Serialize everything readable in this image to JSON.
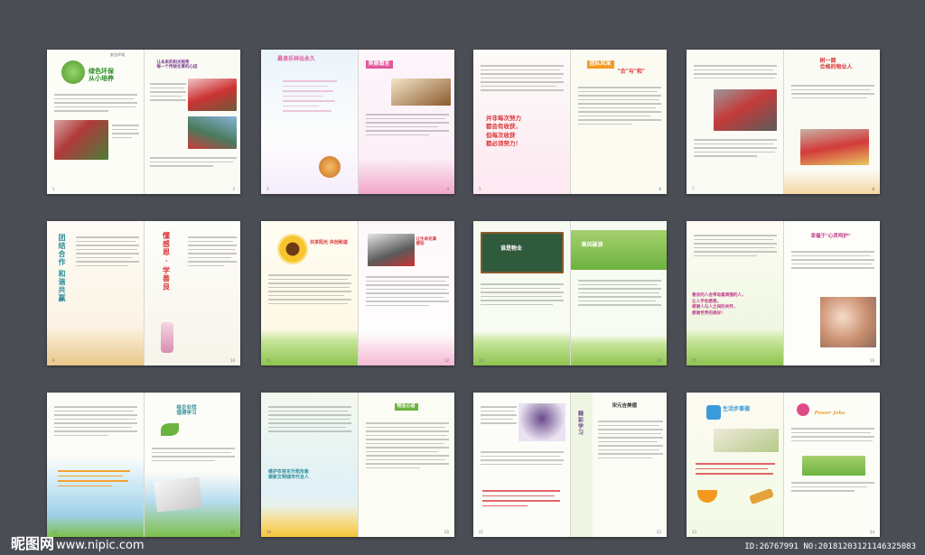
{
  "spreads": [
    {
      "title": "绿色环保\n从小培养",
      "subtitle": "让未来的阳光照亮\n每一个传统化青的心田"
    },
    {
      "title": "悬浪乐祥出永久",
      "badge": "美丽感言"
    },
    {
      "title": "并非每次努力\n都会有收获，\n但每次收获\n都必须努力！",
      "badge": "团队风采",
      "subtitle": "\"合\"与\"和\""
    },
    {
      "title": "树一面\n合格的物业人"
    },
    {
      "title": "团结合作 和谐共赢",
      "title2": "懂感恩 · 学善良"
    },
    {
      "title": "共享阳光 共创和谐",
      "badge": "让生命充满\n感动"
    },
    {
      "title": "谁是物业",
      "badge": "乘风破浪"
    },
    {
      "title": "幸福于\"心灵呵护\"",
      "quote": "善良的人会带动着周围的人，\n让人学会感恩。\n感谢人与人之间的关怀，\n感谢世界的美好！"
    },
    {
      "title": "给企业找\n值得学习"
    },
    {
      "title": "维护农林东升凯形象\n做新文明城市代言人",
      "badge": "物业心语"
    },
    {
      "title": "宋元吉美德",
      "side": "精彩学习"
    },
    {
      "title": "生活步事德",
      "title2": "Power Jobs"
    }
  ],
  "watermark": {
    "logo": "昵图网",
    "url": "www.nipic.com",
    "id": "ID:26767991 NO:20181203121146325083"
  },
  "colors": {
    "background": "#4a4d54",
    "accent_green": "#6cb33f",
    "accent_red": "#d9363a",
    "accent_pink": "#e04b87",
    "accent_orange": "#f39a1e"
  }
}
